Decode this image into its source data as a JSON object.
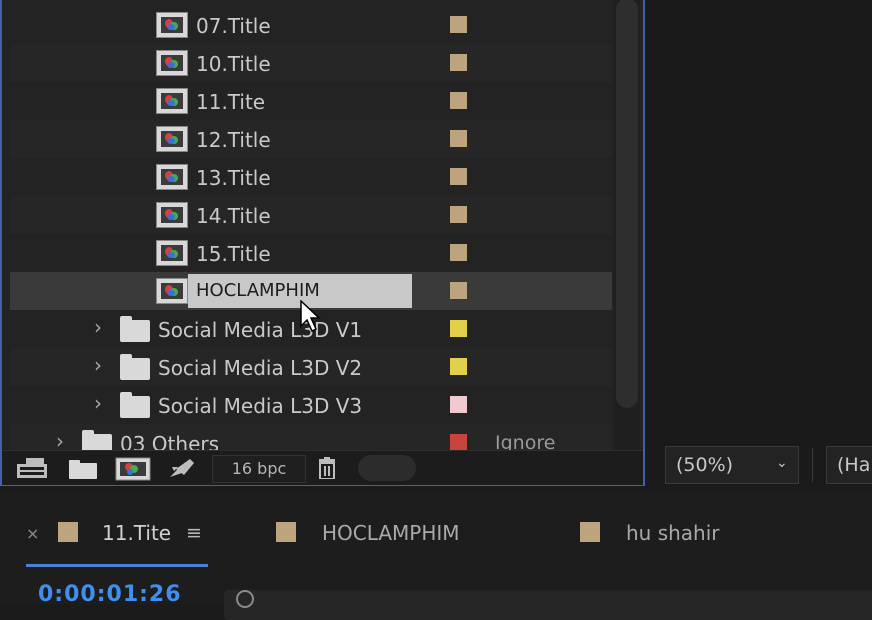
{
  "project": {
    "rows": [
      {
        "type": "comp",
        "label": "07.Title",
        "swatch": "#bda47f",
        "indent": 1,
        "alt": false
      },
      {
        "type": "comp",
        "label": "10.Title",
        "swatch": "#bda47f",
        "indent": 1,
        "alt": true
      },
      {
        "type": "comp",
        "label": "11.Tite",
        "swatch": "#bda47f",
        "indent": 1,
        "alt": false
      },
      {
        "type": "comp",
        "label": "12.Title",
        "swatch": "#bda47f",
        "indent": 1,
        "alt": true
      },
      {
        "type": "comp",
        "label": "13.Title",
        "swatch": "#bda47f",
        "indent": 1,
        "alt": false
      },
      {
        "type": "comp",
        "label": "14.Title",
        "swatch": "#bda47f",
        "indent": 1,
        "alt": true
      },
      {
        "type": "comp",
        "label": "15.Title",
        "swatch": "#bda47f",
        "indent": 1,
        "alt": false
      },
      {
        "type": "comp",
        "label": "HOCLAMPHIM",
        "swatch": "#bda47f",
        "indent": 1,
        "selected": true,
        "editing": true
      },
      {
        "type": "folder",
        "label": "Social Media L3D V1",
        "swatch": "#e2cf4b",
        "indent": 0,
        "alt": false
      },
      {
        "type": "folder",
        "label": "Social Media L3D V2",
        "swatch": "#e2cf4b",
        "indent": 0,
        "alt": true
      },
      {
        "type": "folder",
        "label": "Social Media L3D V3",
        "swatch": "#f1c9cf",
        "indent": 0,
        "alt": false
      },
      {
        "type": "folder",
        "label": "03 Others",
        "swatch": "#c9443b",
        "indent": -1,
        "extra": "Ignore",
        "alt": true
      }
    ],
    "footer": {
      "bpc_label": "16 bpc",
      "icons": [
        "interpret-footage-icon",
        "new-folder-icon",
        "new-composition-icon",
        "render-queue-icon",
        "trash-icon"
      ]
    }
  },
  "viewer": {
    "zoom_value": "(50%)",
    "resolution_value": "(Ha"
  },
  "timeline": {
    "tabs": [
      {
        "label": "11.Tite",
        "swatch": "#bda47f",
        "active": true
      },
      {
        "label": "HOCLAMPHIM",
        "swatch": "#bda47f",
        "active": false
      },
      {
        "label": "hu shahir",
        "swatch": "#bda47f",
        "active": false
      }
    ],
    "close_glyph": "×",
    "menu_glyph": "≡",
    "timecode": "0:00:01:26"
  }
}
